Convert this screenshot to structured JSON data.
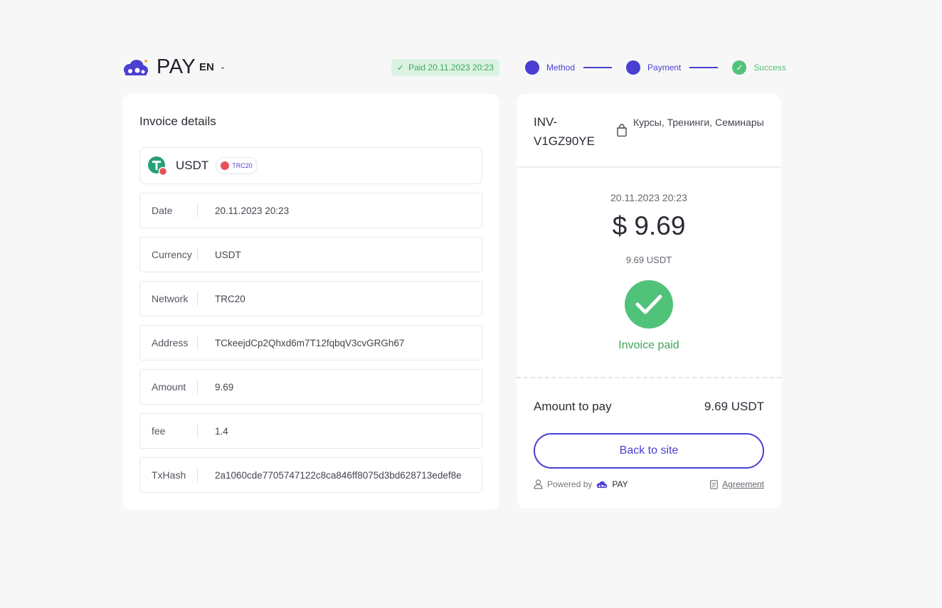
{
  "header": {
    "logo_text": "PAY",
    "language": "EN",
    "paid_badge": "Paid 20.11.2023 20:23",
    "steps": [
      {
        "label": "Method"
      },
      {
        "label": "Payment"
      },
      {
        "label": "Success"
      }
    ]
  },
  "invoice_details": {
    "title": "Invoice details",
    "coin": "USDT",
    "network_chip": "TRC20",
    "rows": [
      {
        "label": "Date",
        "value": "20.11.2023 20:23"
      },
      {
        "label": "Currency",
        "value": "USDT"
      },
      {
        "label": "Network",
        "value": "TRC20"
      },
      {
        "label": "Address",
        "value": "TCkeejdCp2Qhxd6m7T12fqbqV3cvGRGh67"
      },
      {
        "label": "Amount",
        "value": "9.69"
      },
      {
        "label": "fee",
        "value": "1.4"
      },
      {
        "label": "TxHash",
        "value": "2a1060cde7705747122c8ca846ff8075d3bd628713edef8e"
      }
    ]
  },
  "summary": {
    "invoice_id": "INV-V1GZ90YE",
    "category": "Курсы, Тренинги, Семинары",
    "date": "20.11.2023 20:23",
    "amount_usd": "$ 9.69",
    "amount_crypto": "9.69 USDT",
    "status": "Invoice paid",
    "amount_to_pay_label": "Amount to pay",
    "amount_to_pay_value": "9.69 USDT",
    "back_button": "Back to site",
    "powered_by": "Powered by",
    "powered_brand": "PAY",
    "agreement": "Agreement"
  },
  "colors": {
    "accent": "#4a3fd1",
    "success": "#51c27a",
    "background": "#f7f7f8"
  }
}
